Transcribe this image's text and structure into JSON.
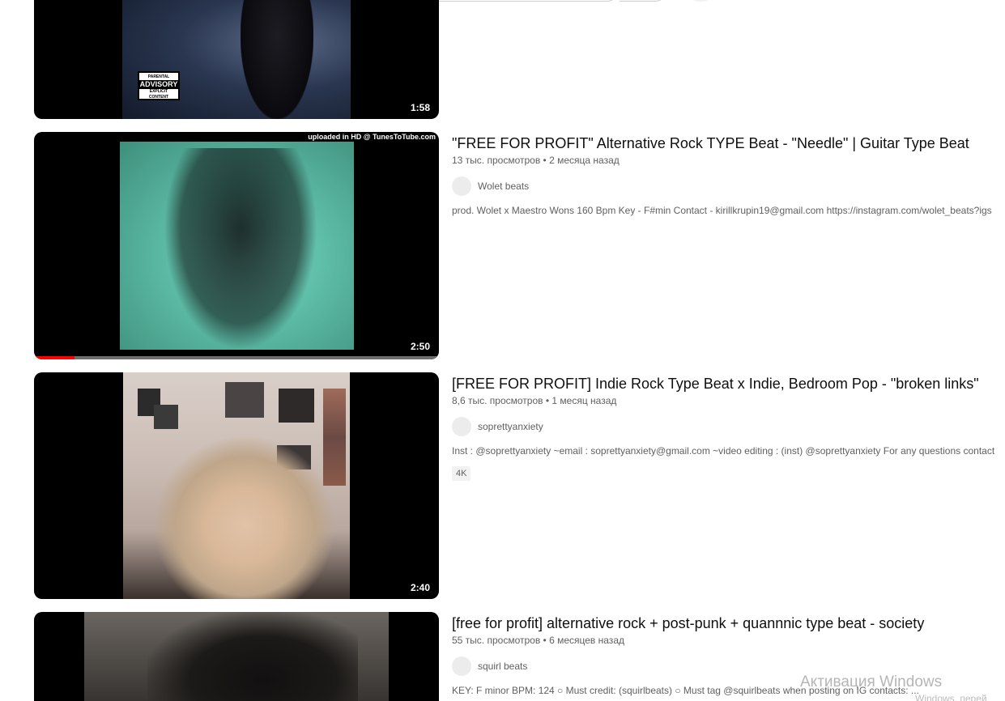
{
  "videos": [
    {
      "title": "",
      "views": "",
      "age": "",
      "channel": "",
      "description": "",
      "duration": "1:58",
      "overlay_text": "PARENTAL ADVISORY EXPLICIT CONTENT"
    },
    {
      "title": "\"FREE FOR PROFIT\" Alternative Rock TYPE Beat - \"Needle\" | Guitar Type Beat",
      "views": "13 тыс. просмотров",
      "age": "2 месяца назад",
      "channel": "Wolet beats",
      "description": "prod. Wolet x Maestro Wons 160 Bpm Key - F#min Contact - kirillkrupin19@gmail.com https://instagram.com/wolet_beats?igs",
      "duration": "2:50",
      "overlay_text": "uploaded in HD @ TunesToTube.com",
      "watched_fraction": 0.1
    },
    {
      "title": "[FREE FOR PROFIT] Indie Rock Type Beat x Indie, Bedroom Pop - \"broken links\"",
      "views": "8,6 тыс. просмотров",
      "age": "1 месяц назад",
      "channel": "soprettyanxiety",
      "description": "Inst : @soprettyanxiety ~email : soprettyanxiety@gmail.com ~video editing : (inst) @soprettyanxiety For any questions contact",
      "badge": "4K",
      "duration": "2:40"
    },
    {
      "title": "[free for profit] alternative rock + post-punk + quannnic type beat - society",
      "views": "55 тыс. просмотров",
      "age": "6 месяцев назад",
      "channel": "squirl beats",
      "description": "KEY: F minor BPM: 124 ○ Must credit: (squirlbeats) ○ Must tag @squirlbeats when posting on IG contacts: ..."
    }
  ],
  "separator": "•",
  "windows_activation": {
    "title": "Активация Windows",
    "subtitle": "Windows, перей"
  }
}
